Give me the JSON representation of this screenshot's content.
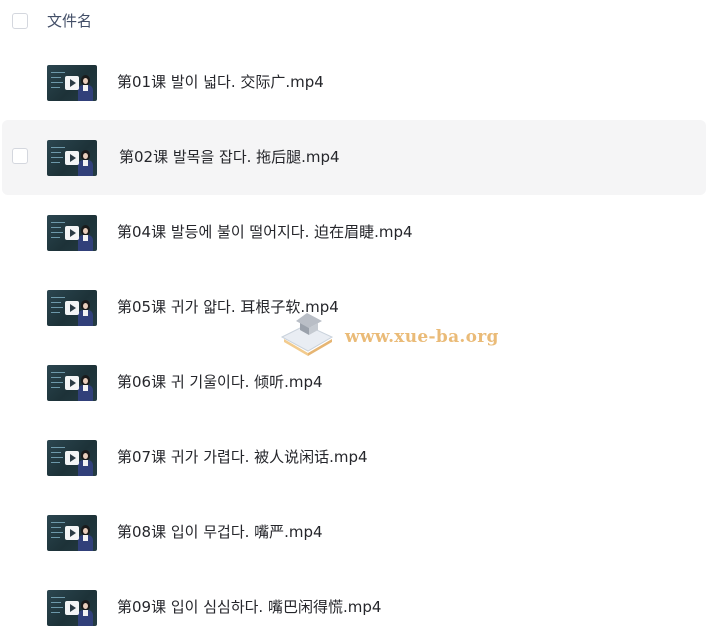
{
  "header": {
    "title": "文件名"
  },
  "files": [
    {
      "name": "第01课 발이 넓다. 交际广.mp4"
    },
    {
      "name": "第02课 발목을 잡다. 拖后腿.mp4"
    },
    {
      "name": "第04课 발등에 불이 떨어지다. 迫在眉睫.mp4"
    },
    {
      "name": "第05课 귀가 얇다. 耳根子软.mp4"
    },
    {
      "name": "第06课 귀 기울이다. 倾听.mp4"
    },
    {
      "name": "第07课 귀가 가렵다. 被人说闲话.mp4"
    },
    {
      "name": "第08课 입이 무겁다. 嘴严.mp4"
    },
    {
      "name": "第09课 입이 심심하다. 嘴巴闲得慌.mp4"
    }
  ],
  "watermark": {
    "text": "www.xue-ba.org",
    "icon": "graduation-cap-logo"
  },
  "colors": {
    "row_hover_bg": "#f5f5f6",
    "header_text": "#424e67",
    "file_text": "#25262b",
    "watermark": "#e8b46a"
  }
}
